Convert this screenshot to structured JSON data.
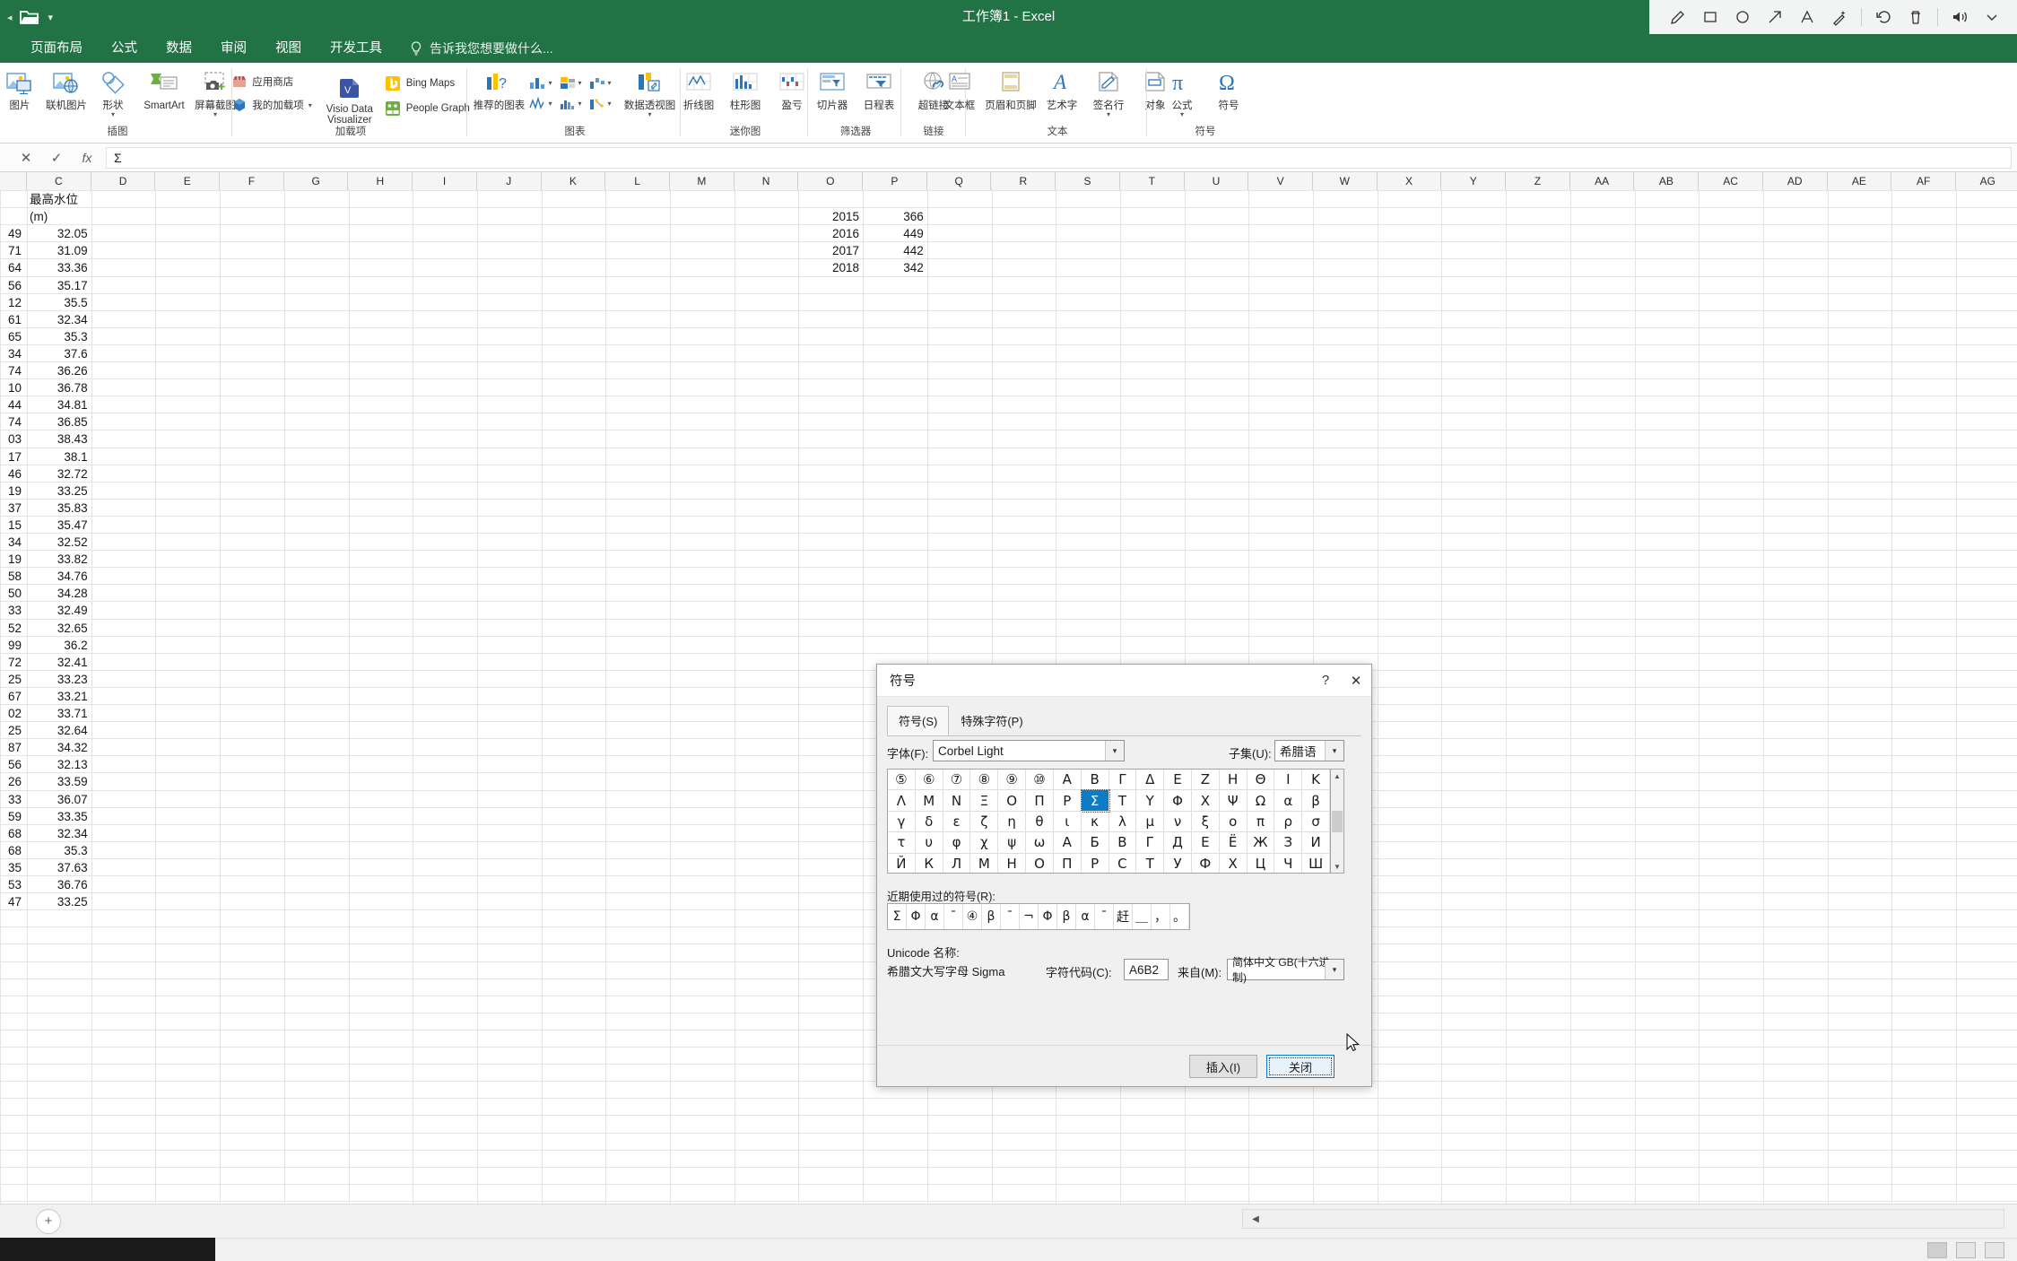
{
  "window": {
    "title": "工作簿1 - Excel"
  },
  "quick_access": {
    "folder_icon": "folder-open-icon",
    "dropdown_icon": "chevron-down-icon"
  },
  "annotation_tools": [
    {
      "name": "pen-icon",
      "glyph": "pen"
    },
    {
      "name": "rectangle-icon",
      "glyph": "rect"
    },
    {
      "name": "ellipse-icon",
      "glyph": "ellipse"
    },
    {
      "name": "arrow-icon",
      "glyph": "arrow"
    },
    {
      "name": "text-icon",
      "glyph": "A"
    },
    {
      "name": "highlighter-icon",
      "glyph": "wand"
    },
    {
      "name": "undo-icon",
      "glyph": "undo"
    },
    {
      "name": "delete-icon",
      "glyph": "trash"
    },
    {
      "name": "speaker-icon",
      "glyph": "speaker"
    }
  ],
  "ribbon_tabs": [
    {
      "label": "页面布局"
    },
    {
      "label": "公式"
    },
    {
      "label": "数据"
    },
    {
      "label": "审阅"
    },
    {
      "label": "视图"
    },
    {
      "label": "开发工具"
    }
  ],
  "tell_me": {
    "label": "告诉我您想要做什么...",
    "icon": "lightbulb-icon"
  },
  "ribbon_groups": [
    {
      "name": "插图",
      "label": "插图",
      "buttons": [
        {
          "label": "图片",
          "icon": "picture-icon"
        },
        {
          "label": "联机图片",
          "icon": "online-picture-icon"
        },
        {
          "label": "形状",
          "icon": "shapes-icon",
          "has_caret": true
        },
        {
          "label": "SmartArt",
          "icon": "smartart-icon"
        },
        {
          "label": "屏幕截图",
          "icon": "screenshot-icon",
          "has_caret": true
        }
      ]
    },
    {
      "name": "加载项",
      "label": "加载项",
      "items": [
        {
          "label": "应用商店",
          "icon": "store-icon"
        },
        {
          "label": "我的加载项",
          "icon": "addins-icon",
          "has_caret": true
        },
        {
          "label": "Visio Data Visualizer",
          "icon": "visio-icon"
        },
        {
          "label": "Bing Maps",
          "icon": "bing-icon"
        },
        {
          "label": "People Graph",
          "icon": "people-graph-icon"
        }
      ]
    },
    {
      "name": "图表",
      "label": "图表",
      "buttons": [
        {
          "label": "推荐的图表",
          "icon": "recommended-charts-icon"
        },
        {
          "label": "数据透视图",
          "icon": "pivot-chart-icon",
          "has_caret": true
        }
      ],
      "mini_charts": [
        {
          "icon": "column-chart-icon"
        },
        {
          "icon": "hierarchy-chart-icon"
        },
        {
          "icon": "waterfall-chart-icon"
        },
        {
          "icon": "line-chart-icon"
        },
        {
          "icon": "statistic-chart-icon"
        },
        {
          "icon": "scatter-chart-icon"
        }
      ]
    },
    {
      "name": "迷你图",
      "label": "迷你图",
      "buttons": [
        {
          "label": "折线图",
          "icon": "sparkline-line-icon"
        },
        {
          "label": "柱形图",
          "icon": "sparkline-column-icon"
        },
        {
          "label": "盈亏",
          "icon": "sparkline-winloss-icon"
        }
      ]
    },
    {
      "name": "筛选器",
      "label": "筛选器",
      "buttons": [
        {
          "label": "切片器",
          "icon": "slicer-icon"
        },
        {
          "label": "日程表",
          "icon": "timeline-icon"
        }
      ]
    },
    {
      "name": "链接",
      "label": "链接",
      "buttons": [
        {
          "label": "超链接",
          "icon": "hyperlink-icon"
        }
      ]
    },
    {
      "name": "文本",
      "label": "文本",
      "buttons": [
        {
          "label": "文本框",
          "icon": "textbox-icon"
        },
        {
          "label": "页眉和页脚",
          "icon": "header-footer-icon"
        },
        {
          "label": "艺术字",
          "icon": "wordart-icon"
        },
        {
          "label": "签名行",
          "icon": "signature-line-icon",
          "has_caret": true
        },
        {
          "label": "对象",
          "icon": "object-icon"
        }
      ]
    },
    {
      "name": "符号",
      "label": "符号",
      "buttons": [
        {
          "label": "公式",
          "icon": "equation-pi-icon",
          "has_caret": true
        },
        {
          "label": "符号",
          "icon": "symbol-omega-icon"
        }
      ]
    }
  ],
  "formula_bar": {
    "cancel_icon": "cancel-x-icon",
    "enter_icon": "check-icon",
    "function_icon": "fx-icon",
    "value": "Σ"
  },
  "grid": {
    "columns": [
      "C",
      "D",
      "E",
      "F",
      "G",
      "H",
      "I",
      "J",
      "K",
      "L",
      "M",
      "N",
      "O",
      "P",
      "Q",
      "R",
      "S",
      "T",
      "U",
      "V",
      "W",
      "X",
      "Y",
      "Z",
      "AA",
      "AB",
      "AC",
      "AD",
      "AE",
      "AF",
      "AG"
    ],
    "column_c_header": "最高水位",
    "column_c_unit": "(m)",
    "column_b_partial": [
      "",
      "",
      "49",
      "71",
      "64",
      "56",
      "12",
      "61",
      "65",
      "34",
      "74",
      "10",
      "44",
      "74",
      "03",
      "17",
      "46",
      "19",
      "37",
      "15",
      "34",
      "19",
      "58",
      "50",
      "33",
      "52",
      "99",
      "72",
      "25",
      "67",
      "02",
      "25",
      "87",
      "56",
      "26",
      "33",
      "59",
      "68",
      "68",
      "35",
      "53",
      "47"
    ],
    "column_c_values": [
      "",
      "",
      "32.05",
      "31.09",
      "33.36",
      "35.17",
      "35.5",
      "32.34",
      "35.3",
      "37.6",
      "36.26",
      "36.78",
      "34.81",
      "36.85",
      "38.43",
      "38.1",
      "32.72",
      "33.25",
      "35.83",
      "35.47",
      "32.52",
      "33.82",
      "34.76",
      "34.28",
      "32.49",
      "32.65",
      "36.2",
      "32.41",
      "33.23",
      "33.21",
      "33.71",
      "32.64",
      "34.32",
      "32.13",
      "33.59",
      "36.07",
      "33.35",
      "32.34",
      "35.3",
      "37.63",
      "36.76",
      "33.25"
    ],
    "column_o_values": [
      "2015",
      "2016",
      "2017",
      "2018"
    ],
    "column_p_values": [
      "366",
      "449",
      "442",
      "342"
    ]
  },
  "dialog": {
    "title": "符号",
    "help_icon": "question-mark-icon",
    "close_icon": "close-x-icon",
    "tabs": [
      {
        "label": "符号(S)",
        "selected": true
      },
      {
        "label": "特殊字符(P)",
        "selected": false
      }
    ],
    "font_label": "字体(F):",
    "font_value": "Corbel Light",
    "subset_label": "子集(U):",
    "subset_value": "希腊语",
    "symbol_rows": [
      [
        "⑤",
        "⑥",
        "⑦",
        "⑧",
        "⑨",
        "⑩",
        "Α",
        "Β",
        "Γ",
        "Δ",
        "Ε",
        "Ζ",
        "Η",
        "Θ",
        "Ι",
        "Κ"
      ],
      [
        "Λ",
        "Μ",
        "Ν",
        "Ξ",
        "Ο",
        "Π",
        "Ρ",
        "Σ",
        "Τ",
        "Υ",
        "Φ",
        "Χ",
        "Ψ",
        "Ω",
        "α",
        "β"
      ],
      [
        "γ",
        "δ",
        "ε",
        "ζ",
        "η",
        "θ",
        "ι",
        "κ",
        "λ",
        "μ",
        "ν",
        "ξ",
        "ο",
        "π",
        "ρ",
        "σ"
      ],
      [
        "τ",
        "υ",
        "φ",
        "χ",
        "ψ",
        "ω",
        "А",
        "Б",
        "В",
        "Г",
        "Д",
        "Е",
        "Ё",
        "Ж",
        "З",
        "И"
      ],
      [
        "Й",
        "К",
        "Л",
        "М",
        "Н",
        "О",
        "П",
        "Р",
        "С",
        "Т",
        "У",
        "Ф",
        "Х",
        "Ц",
        "Ч",
        "Ш"
      ]
    ],
    "selected_symbol": {
      "row": 1,
      "col": 7,
      "char": "Σ"
    },
    "recent_label": "近期使用过的符号(R):",
    "recent_symbols": [
      "Σ",
      "Φ",
      "α",
      "ˉ",
      "④",
      "β",
      "ˉ",
      "¬",
      "Φ",
      "β",
      "α",
      "ˉ",
      "赶",
      "＿",
      "，",
      "。"
    ],
    "unicode_label": "Unicode 名称:",
    "unicode_name": "希腊文大写字母 Sigma",
    "charcode_label": "字符代码(C):",
    "charcode_value": "A6B2",
    "from_label": "来自(M):",
    "from_value": "简体中文 GB(十六进制)",
    "insert_button": "插入(I)",
    "close_button": "关闭"
  },
  "status_bar": {
    "add_sheet_icon": "plus-circle-icon",
    "view_normal_icon": "normal-view-icon",
    "view_layout_icon": "page-layout-view-icon",
    "view_pagebreak_icon": "page-break-view-icon"
  },
  "colors": {
    "excel_green": "#217346",
    "accent_blue": "#0f7bc4",
    "ribbon_bg": "#ffffff"
  }
}
